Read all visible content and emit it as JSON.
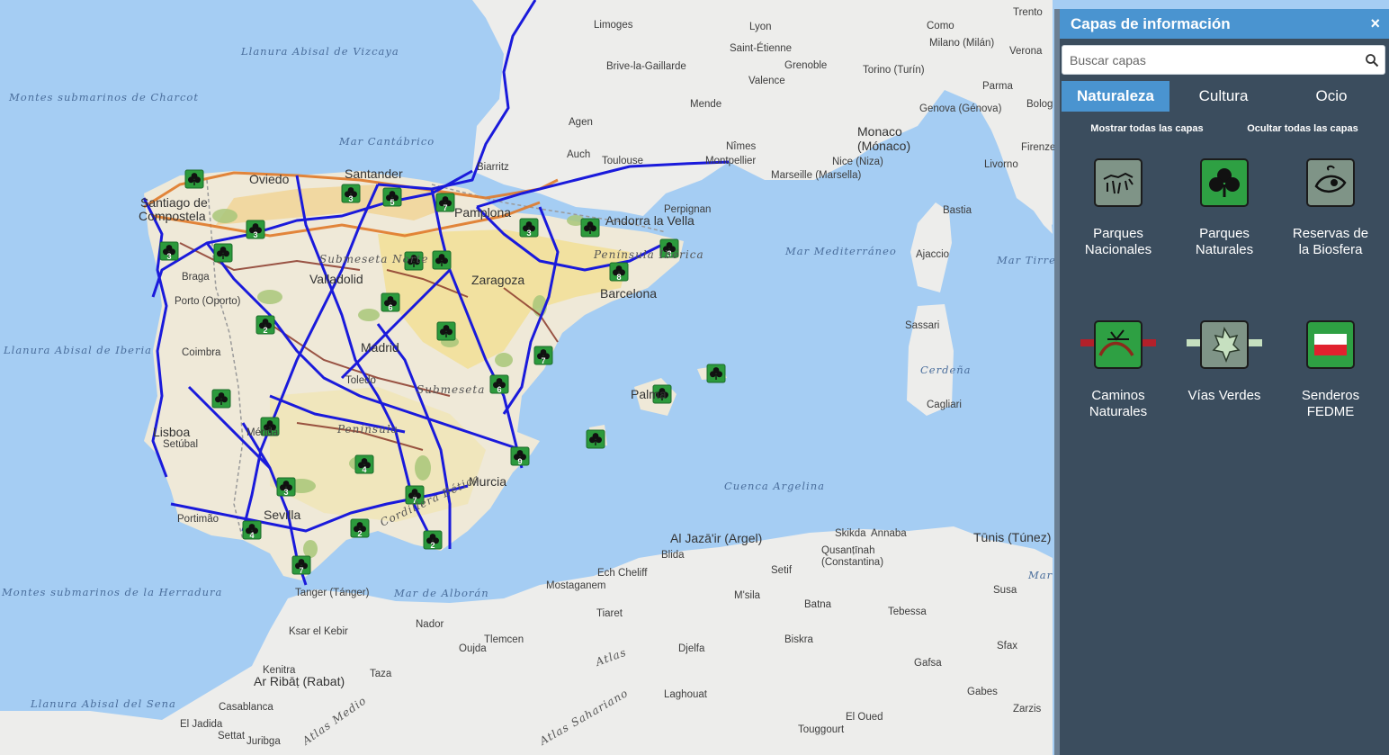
{
  "panel": {
    "title": "Capas de información",
    "close_label": "×",
    "search_placeholder": "Buscar capas",
    "tabs": [
      {
        "label": "Naturaleza",
        "active": true
      },
      {
        "label": "Cultura",
        "active": false
      },
      {
        "label": "Ocio",
        "active": false
      }
    ],
    "show_all": "Mostrar todas las capas",
    "hide_all": "Ocultar todas las capas",
    "layers": [
      {
        "label_1": "Parques",
        "label_2": "Nacionales",
        "icon": "parques-nacionales-icon"
      },
      {
        "label_1": "Parques",
        "label_2": "Naturales",
        "icon": "clover-icon"
      },
      {
        "label_1": "Reservas de",
        "label_2": "la Biosfera",
        "icon": "biosfera-icon"
      },
      {
        "label_1": "Caminos",
        "label_2": "Naturales",
        "icon": "caminos-naturales-icon"
      },
      {
        "label_1": "Vías Verdes",
        "label_2": "",
        "icon": "vias-verdes-icon"
      },
      {
        "label_1": "Senderos",
        "label_2": "FEDME",
        "icon": "senderos-fedme-icon"
      }
    ]
  },
  "map": {
    "colors": {
      "sea": "#a5cdf3",
      "land": "#ededeb",
      "route": "#1a1adb",
      "green_way": "#e07a2a",
      "park": "#2c9a3c"
    },
    "labels": {
      "sea": [
        "Llanura Abisal de Vizcaya",
        "Montes submarinos de Charcot",
        "Mar Cantábrico",
        "Llanura Abisal de Iberia",
        "Mar Mediterráneo",
        "Mar Tirren",
        "Cerdeña",
        "Cuenca Argelina",
        "Montes submarinos de la Herradura",
        "Mar de Alborán",
        "Llanura Abisal del Sena",
        "Mar"
      ],
      "places": [
        "Limoges",
        "Lyon",
        "Trento",
        "Como",
        "Milano (Milán)",
        "Verona",
        "Saint-Étienne",
        "Grenoble",
        "Torino (Turín)",
        "Brive-la-Gaillarde",
        "Valence",
        "Parma",
        "Mende",
        "Genova (Génova)",
        "Bolog",
        "Agen",
        "Monaco",
        "(Mónaco)",
        "Nîmes",
        "Firenze",
        "Auch",
        "Toulouse",
        "Montpellier",
        "Nice (Niza)",
        "Livorno",
        "Marseille (Marsella)",
        "Biarritz",
        "Santander",
        "Oviedo",
        "Santiago de",
        "Compostela",
        "Pamplona",
        "Perpignan",
        "Andorra la Vella",
        "Bastia",
        "Ajaccio",
        "Braga",
        "Valladolid",
        "Zaragoza",
        "Barcelona",
        "Porto (Oporto)",
        "Sassari",
        "Coimbra",
        "Madrid",
        "Toledo",
        "Palma",
        "Cagliari",
        "Lisboa",
        "Setúbal",
        "Mérida",
        "Murcia",
        "Portimão",
        "Sevilla",
        "Al Jazā'ir (Argel)",
        "Blida",
        "Skikda",
        "Annaba",
        "Qusanṭīnah",
        "(Constantina)",
        "Tūnis (Túnez)",
        "Tanger (Tánger)",
        "Ech Cheliff",
        "Mostaganem",
        "Setif",
        "M'sila",
        "Batna",
        "Susa",
        "Tebessa",
        "Tiaret",
        "Nador",
        "Ksar el Kebir",
        "Tlemcen",
        "Oujda",
        "Djelfa",
        "Biskra",
        "Sfax",
        "Kenitra",
        "Ar Ribāṭ (Rabat)",
        "Taza",
        "Gafsa",
        "Gabes",
        "Laghouat",
        "Casablanca",
        "Zarzis",
        "El Jadida",
        "El Oued",
        "Settat",
        "Juribga",
        "Touggourt"
      ],
      "regions": [
        "Submeseta Norte",
        "Península Ibérica",
        "Submeseta",
        "Península",
        "Cordillera Bética",
        "Atlas",
        "Atlas Medio",
        "Atlas Sahariano"
      ]
    },
    "markers": [
      {
        "n": ""
      },
      {
        "n": "3"
      },
      {
        "n": "5"
      },
      {
        "n": "7"
      },
      {
        "n": "3"
      },
      {
        "n": "3"
      },
      {
        "n": ""
      },
      {
        "n": "3"
      },
      {
        "n": ""
      },
      {
        "n": ""
      },
      {
        "n": "3"
      },
      {
        "n": "8"
      },
      {
        "n": "6"
      },
      {
        "n": "2"
      },
      {
        "n": ""
      },
      {
        "n": "7"
      },
      {
        "n": "6"
      },
      {
        "n": ""
      },
      {
        "n": ""
      },
      {
        "n": ""
      },
      {
        "n": ""
      },
      {
        "n": "4"
      },
      {
        "n": "3"
      },
      {
        "n": "7"
      },
      {
        "n": "9"
      },
      {
        "n": ""
      },
      {
        "n": "2"
      },
      {
        "n": "2"
      },
      {
        "n": "7"
      },
      {
        "n": "4"
      },
      {
        "n": ""
      }
    ]
  }
}
